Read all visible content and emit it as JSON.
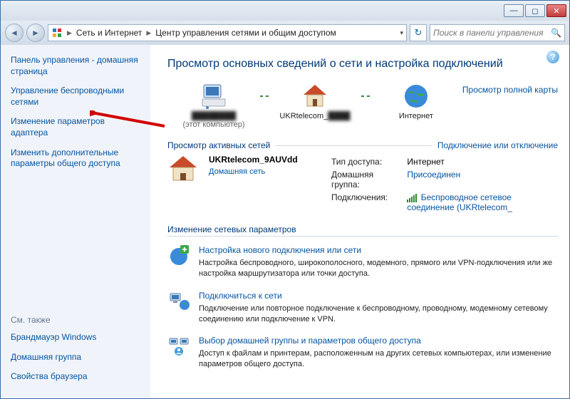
{
  "titlebar": {
    "min": "—",
    "max": "◻",
    "close": "✕"
  },
  "breadcrumb": {
    "seg1": "Сеть и Интернет",
    "seg2": "Центр управления сетями и общим доступом"
  },
  "search": {
    "placeholder": "Поиск в панели управления"
  },
  "sidebar": {
    "items": [
      "Панель управления - домашняя страница",
      "Управление беспроводными сетями",
      "Изменение параметров адаптера",
      "Изменить дополнительные параметры общего доступа"
    ],
    "see_also_label": "См. также",
    "see_also": [
      "Брандмауэр Windows",
      "Домашняя группа",
      "Свойства браузера"
    ]
  },
  "main": {
    "heading": "Просмотр основных сведений о сети и настройка подключений",
    "map_full": "Просмотр полной карты",
    "node_pc_sub": "(этот компьютер)",
    "node_net": "UKRtelecom_",
    "node_internet": "Интернет",
    "active_nets_label": "Просмотр активных сетей",
    "connect_link": "Подключение или отключение",
    "net_name": "UKRtelecom_9AUVdd",
    "net_type": "Домашняя сеть",
    "props": {
      "access_label": "Тип доступа:",
      "access_value": "Интернет",
      "hg_label": "Домашняя группа:",
      "hg_value": "Присоединен",
      "conn_label": "Подключения:",
      "conn_value": "Беспроводное сетевое соединение (UKRtelecom_"
    },
    "change_heading": "Изменение сетевых параметров",
    "tasks": [
      {
        "title": "Настройка нового подключения или сети",
        "desc": "Настройка беспроводного, широкополосного, модемного, прямого или VPN-подключения или же настройка маршрутизатора или точки доступа."
      },
      {
        "title": "Подключиться к сети",
        "desc": "Подключение или повторное подключение к беспроводному, проводному, модемному сетевому соединению или подключение к VPN."
      },
      {
        "title": "Выбор домашней группы и параметров общего доступа",
        "desc": "Доступ к файлам и принтерам, расположенным на других сетевых компьютерах, или изменение параметров общего доступа."
      }
    ]
  }
}
